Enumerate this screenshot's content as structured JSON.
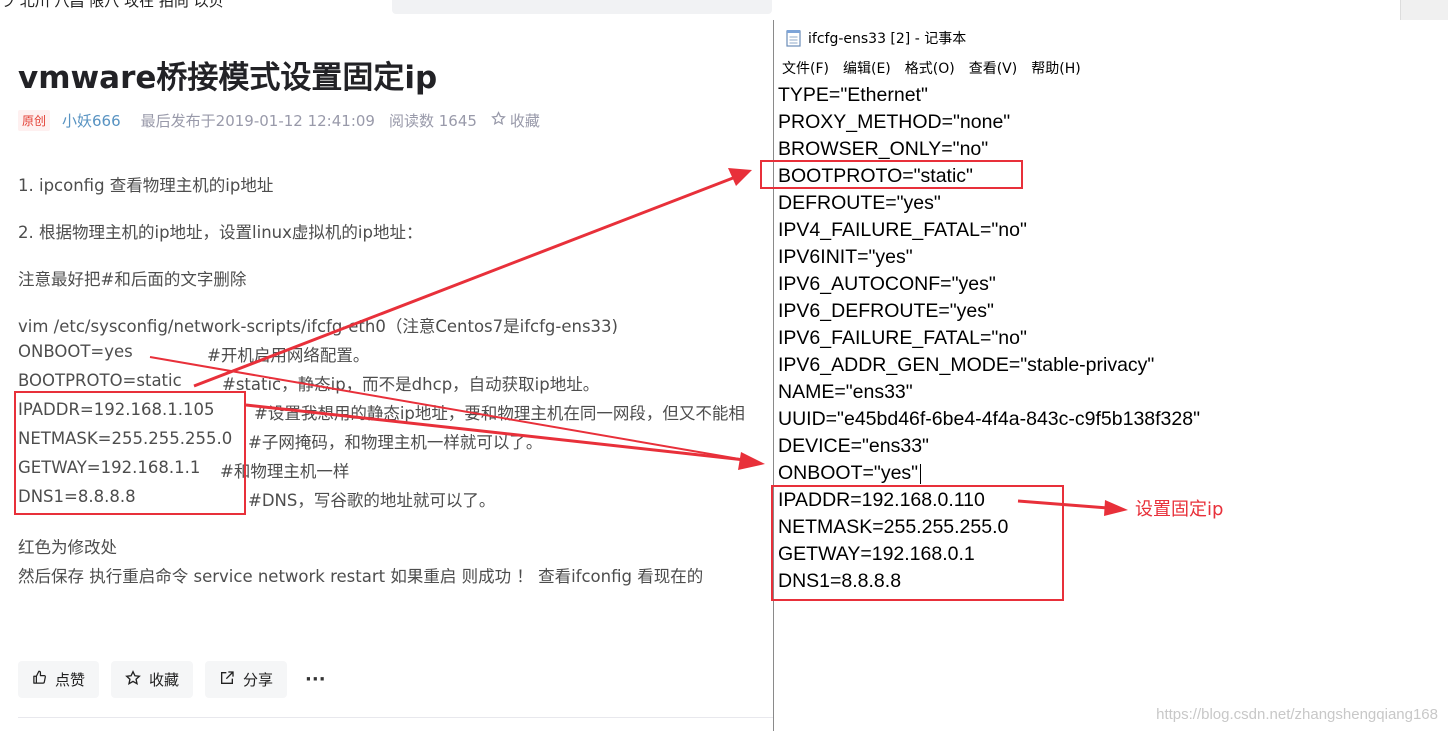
{
  "topnav": {
    "fragment": "ラ   北川  八昌   限八   攻在  拍向               以贝"
  },
  "article": {
    "title": "vmware桥接模式设置固定ip",
    "meta": {
      "badge": "原创",
      "author": "小妖666",
      "published": "最后发布于2019-01-12 12:41:09",
      "reads": "阅读数 1645",
      "favorite": "收藏"
    },
    "paragraphs": [
      "1. ipconfig 查看物理主机的ip地址",
      "2. 根据物理主机的ip地址，设置linux虚拟机的ip地址：",
      "注意最好把#和后面的文字删除"
    ],
    "code": [
      {
        "text": "vim /etc/sysconfig/network-scripts/ifcfg-eth0（注意Centos7是ifcfg-ens33)",
        "comment": ""
      },
      {
        "text": "ONBOOT=yes",
        "comment": "#开机启用网络配置。"
      },
      {
        "text": "BOOTPROTO=static",
        "comment": "#static，静态ip，而不是dhcp，自动获取ip地址。"
      },
      {
        "text": "IPADDR=192.168.1.105",
        "comment": "#设置我想用的静态ip地址，要和物理主机在同一网段，但又不能相"
      },
      {
        "text": "NETMASK=255.255.255.0",
        "comment": "#子网掩码，和物理主机一样就可以了。"
      },
      {
        "text": "GETWAY=192.168.1.1",
        "comment": "#和物理主机一样"
      },
      {
        "text": "DNS1=8.8.8.8",
        "comment": "#DNS，写谷歌的地址就可以了。"
      }
    ],
    "after": [
      "红色为修改处",
      "然后保存   执行重启命令 service network restart   如果重启 则成功  ！  查看ifconfig 看现在的"
    ],
    "actions": {
      "like": "点赞",
      "collect": "收藏",
      "share": "分享",
      "more": "···"
    }
  },
  "notepad": {
    "title": "ifcfg-ens33 [2] - 记事本",
    "menu": [
      "文件(F)",
      "编辑(E)",
      "格式(O)",
      "查看(V)",
      "帮助(H)"
    ],
    "lines": [
      "TYPE=\"Ethernet\"",
      "PROXY_METHOD=\"none\"",
      "BROWSER_ONLY=\"no\"",
      "BOOTPROTO=\"static\"",
      "DEFROUTE=\"yes\"",
      "IPV4_FAILURE_FATAL=\"no\"",
      "IPV6INIT=\"yes\"",
      "IPV6_AUTOCONF=\"yes\"",
      "IPV6_DEFROUTE=\"yes\"",
      "IPV6_FAILURE_FATAL=\"no\"",
      "IPV6_ADDR_GEN_MODE=\"stable-privacy\"",
      "NAME=\"ens33\"",
      "UUID=\"e45bd46f-6be4-4f4a-843c-c9f5b138f328\"",
      "DEVICE=\"ens33\"",
      "ONBOOT=\"yes\"",
      "IPADDR=192.168.0.110",
      "NETMASK=255.255.255.0",
      "GETWAY=192.168.0.1",
      "DNS1=8.8.8.8"
    ]
  },
  "annotation": {
    "note": "设置固定ip",
    "color": "#e8303a"
  },
  "watermark": "https://blog.csdn.net/zhangshengqiang168"
}
